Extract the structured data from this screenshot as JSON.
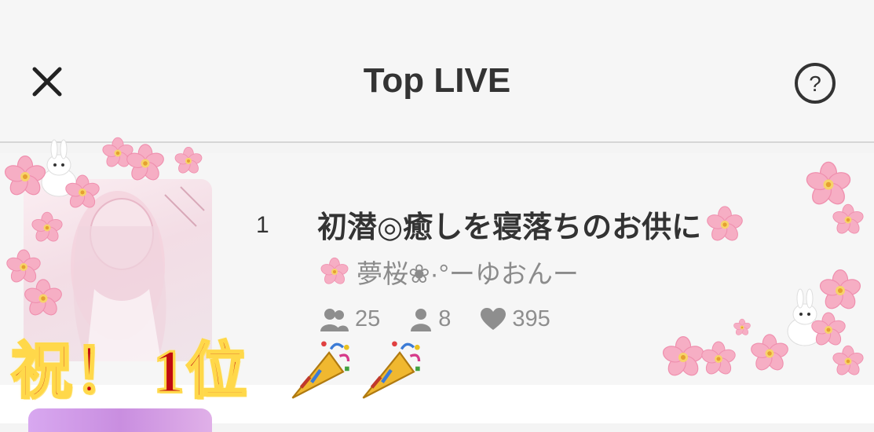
{
  "header": {
    "title": "Top LIVE"
  },
  "ranking": [
    {
      "rank": "1",
      "title": "初潜◎癒しを寝落ちのお供に",
      "streamer": "夢桜❀·°ーゆおんー",
      "viewers": "25",
      "listeners": "8",
      "likes": "395"
    }
  ],
  "celebration": {
    "text": "祝！ 1位"
  },
  "icons": {
    "close": "close-icon",
    "help": "help-icon",
    "viewers": "viewers-icon",
    "listeners": "person-icon",
    "likes": "heart-icon",
    "blossom": "cherry-blossom-icon",
    "party": "party-popper-icon"
  },
  "colors": {
    "text_primary": "#333333",
    "text_secondary": "#8b8b8b",
    "celebration_red": "#c00a10",
    "celebration_outline": "#ffd84a",
    "blossom_pink": "#f4a6bf"
  }
}
